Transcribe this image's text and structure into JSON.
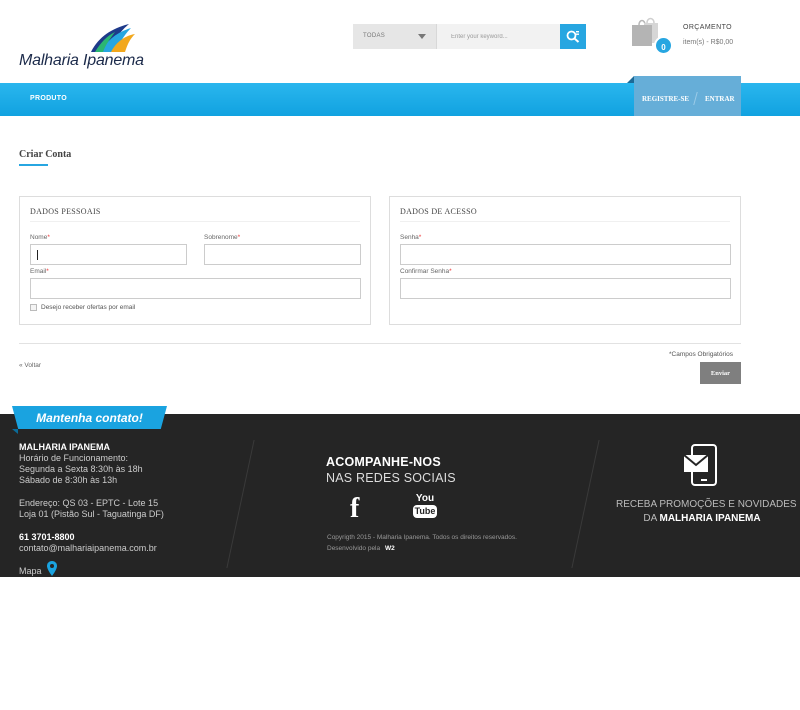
{
  "brand": {
    "name": "Malharia Ipanema"
  },
  "search": {
    "category": "TODAS",
    "placeholder": "Enter your keyword..."
  },
  "cart": {
    "title": "ORÇAMENTO",
    "count": "0",
    "summary": "item(s) - R$0,00"
  },
  "nav": {
    "produto": "PRODUTO",
    "registrar": "REGISTRE-SE",
    "entrar": "ENTRAR"
  },
  "page": {
    "title": "Criar Conta"
  },
  "dados_pessoais": {
    "title": "DADOS PESSOAIS",
    "nome_label": "Nome",
    "sobrenome_label": "Sobrenome",
    "email_label": "Email",
    "required_mark": "*",
    "newsletter_label": "Desejo receber ofertas por email"
  },
  "dados_acesso": {
    "title": "DADOS DE ACESSO",
    "senha_label": "Senha",
    "confirmar_label": "Confirmar Senha",
    "required_mark": "*"
  },
  "actions": {
    "required_note": "*Campos Obrigatórios",
    "voltar": "« Voltar",
    "enviar": "Enviar"
  },
  "footer": {
    "ribbon": "Mantenha contato!",
    "company": "MALHARIA IPANEMA",
    "hours_title": "Horário de Funcionamento:",
    "hours_week": "Segunda a Sexta 8:30h às 18h",
    "hours_sat": "Sábado de 8:30h às 13h",
    "address1": "Endereço: QS 03 - EPTC - Lote 15",
    "address2": "Loja 01 (Pistão Sul - Taguatinga DF)",
    "phone": "61 3701-8800",
    "email": "contato@malhariaipanema.com.br",
    "mapa": "Mapa",
    "follow1": "ACOMPANHE-NOS",
    "follow2": "NAS REDES SOCIAIS",
    "facebook": "f",
    "youtube_top": "You",
    "youtube_bottom": "Tube",
    "copyright": "Copyrigth 2015 - Malharia Ipanema. Todos os direitos reservados.",
    "developed_by": "Desenvolvido pela",
    "developer": "W2",
    "promo1": "RECEBA PROMOÇÕES E NOVIDADES",
    "promo2_prefix": "DA",
    "promo2_brand": "MALHARIA IPANEMA"
  },
  "colors": {
    "accent": "#27a6e1",
    "footer_bg": "#252525",
    "button_gray": "#7f7f7f"
  },
  "icons": [
    "logo-leaf-icon",
    "chevron-down-icon",
    "search-icon",
    "shopping-bag-icon",
    "map-pin-icon",
    "facebook-icon",
    "youtube-icon",
    "mobile-mail-icon"
  ]
}
